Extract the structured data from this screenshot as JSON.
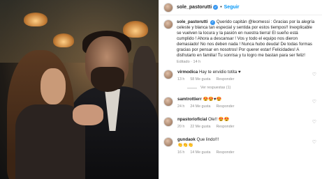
{
  "post": {
    "username": "sole_pastorutti",
    "follow_label": "Seguir",
    "dot": "•",
    "verified_mark": "✓"
  },
  "caption": {
    "username": "sole_pastorutti",
    "text": "Querido capitán @leomessi : Gracias por la alegría celeste y blanca tan especial y sentida por estos tiempos!! Inexplicable se vuelven la locura y la pasión en nuestra tierra! El sueño está cumplido ! Ahora a descansar ! Vos y todo el equipo nos dieron demasiado! No nos deben nada ! Nunca hubo deuda! De todas formas gracias por pensar en nosotros! Por querer estar! Felicidades! A disfrutarlo en familia! Tu sonrisa y tu logro me bastan para ser feliz!",
    "meta": "Editado · 14 h"
  },
  "comments": [
    {
      "username": "virmodica",
      "text": "Hay te envidio totita ♥",
      "time": "13 h",
      "likes": "58 Me gusta",
      "reply": "Responder",
      "view_replies": "Ver respuestas (1)"
    },
    {
      "username": "samtrottierr",
      "text": "😍😍♥😍",
      "time": "24 h",
      "likes": "24 Me gusta",
      "reply": "Responder"
    },
    {
      "username": "npastorioficial",
      "text": "Ole!! 😍😍",
      "time": "20 h",
      "likes": "22 Me gusta",
      "reply": "Responder"
    },
    {
      "username": "gundaok",
      "text": "Que lindo!!!",
      "time": "16 h",
      "likes": "14 Me gusta",
      "reply": "Responder",
      "emoji": "👏👏👏"
    }
  ],
  "icons": {
    "heart": "heart-icon"
  },
  "colors": {
    "link": "#0095f6",
    "verified": "#3897f0",
    "meta": "#8e8e8e",
    "heart_red": "#ed4956"
  }
}
